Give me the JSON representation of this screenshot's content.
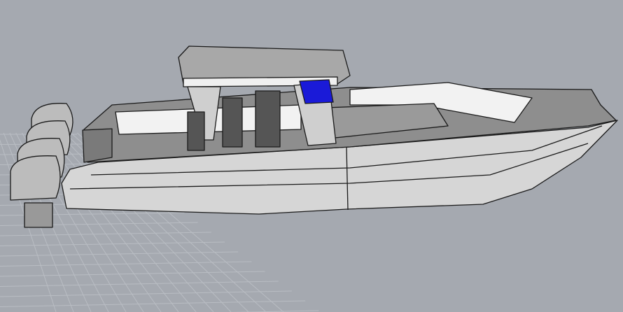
{
  "viewport": {
    "background_color": "#a5a9b0",
    "grid_color": "#b9bdc3",
    "model_fill": "#d9d9d9",
    "model_shadow": "#8c8c8c",
    "deck_white": "#f2f2f2",
    "outline_color": "#1a1a1a",
    "selection_color": "#1a1ad8"
  }
}
